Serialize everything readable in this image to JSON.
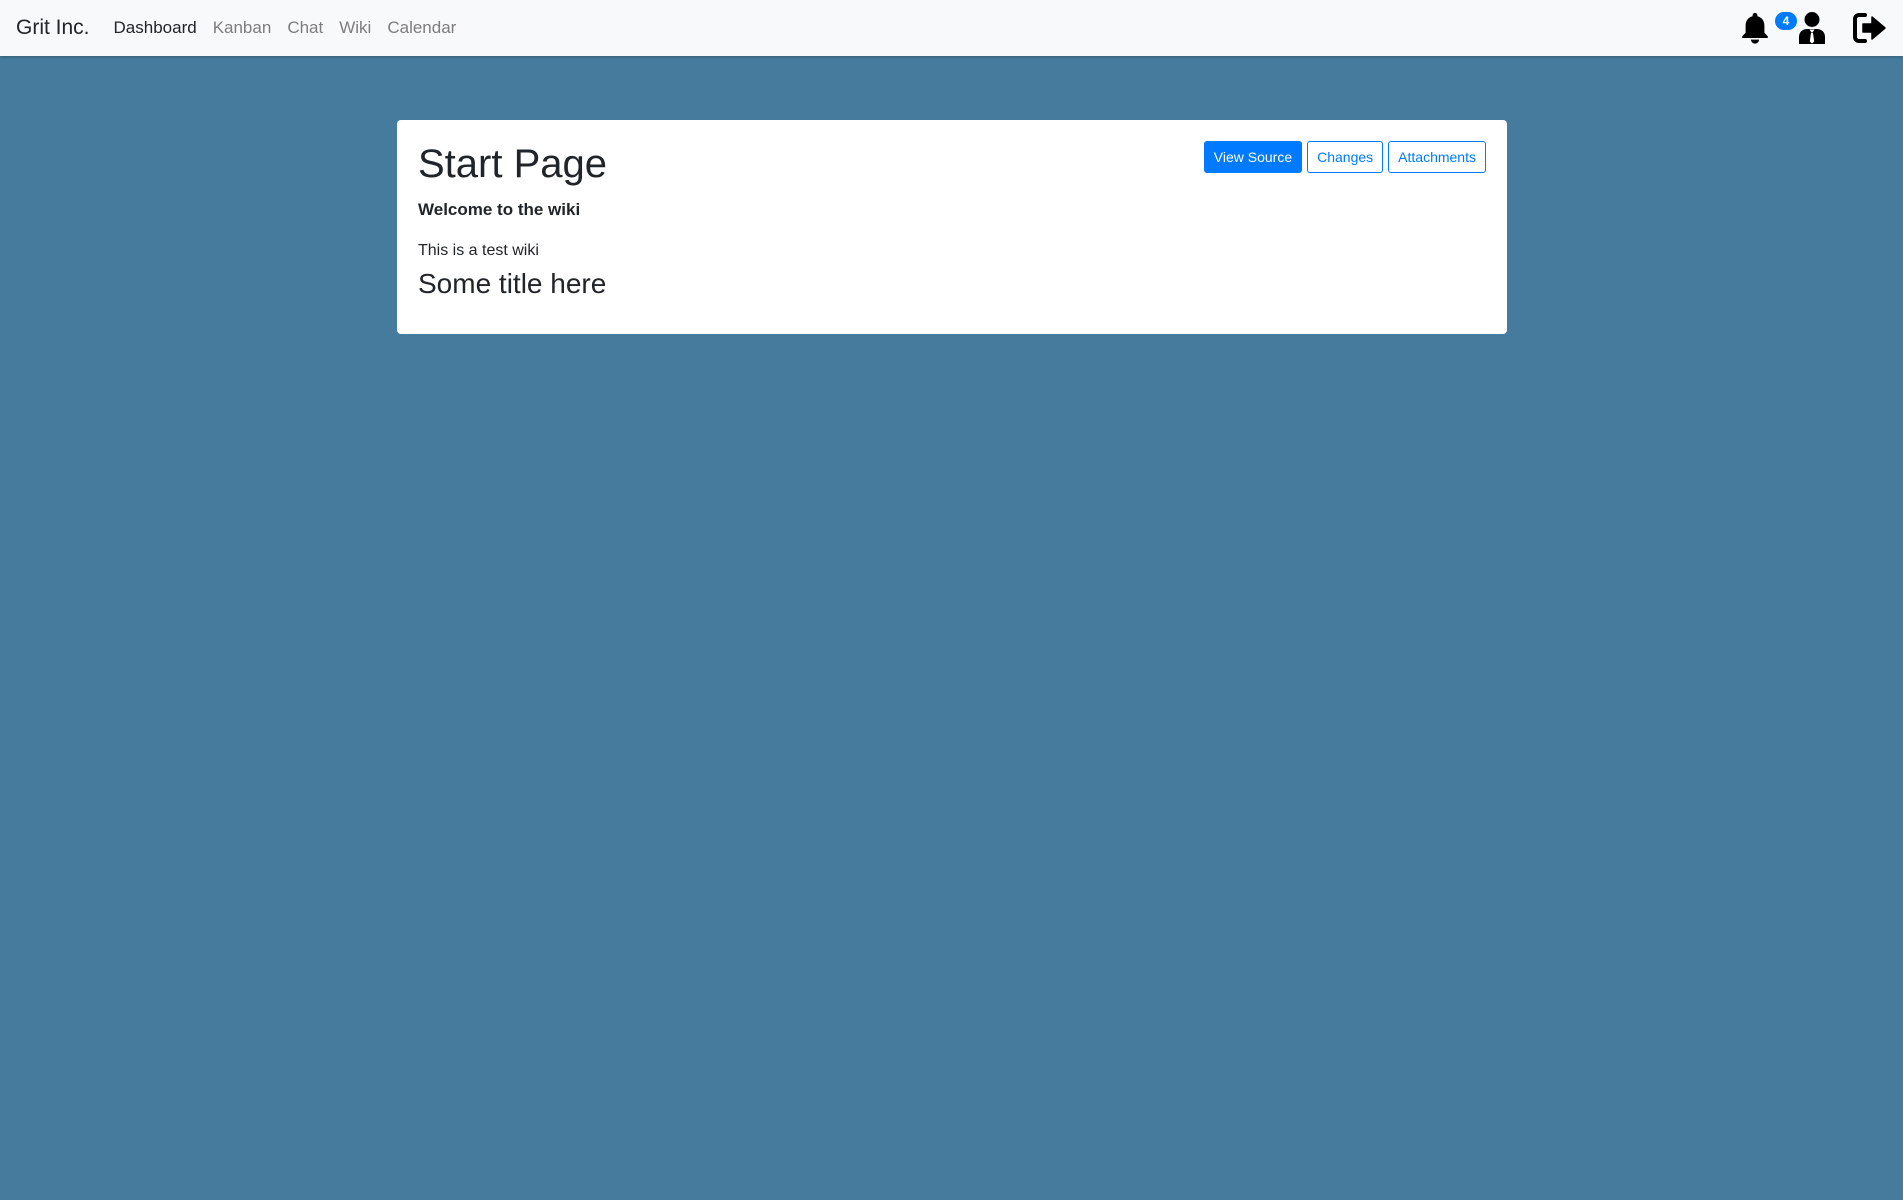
{
  "app": {
    "brand": "Grit Inc."
  },
  "nav": {
    "items": [
      {
        "label": "Dashboard",
        "active": true
      },
      {
        "label": "Kanban",
        "active": false
      },
      {
        "label": "Chat",
        "active": false
      },
      {
        "label": "Wiki",
        "active": false
      },
      {
        "label": "Calendar",
        "active": false
      }
    ]
  },
  "header_right": {
    "notifications": {
      "icon": "bell-icon",
      "count": "4"
    },
    "profile": {
      "icon": "user-icon"
    },
    "logout": {
      "icon": "logout-icon"
    }
  },
  "page": {
    "title": "Start Page",
    "subtitle": "Welcome to the wiki",
    "body": "This is a test wiki",
    "section_title": "Some title here"
  },
  "actions": {
    "view_source": "View Source",
    "changes": "Changes",
    "attachments": "Attachments"
  },
  "colors": {
    "background": "#467b9e",
    "navbar": "#f8f9fa",
    "primary": "#007bff"
  }
}
